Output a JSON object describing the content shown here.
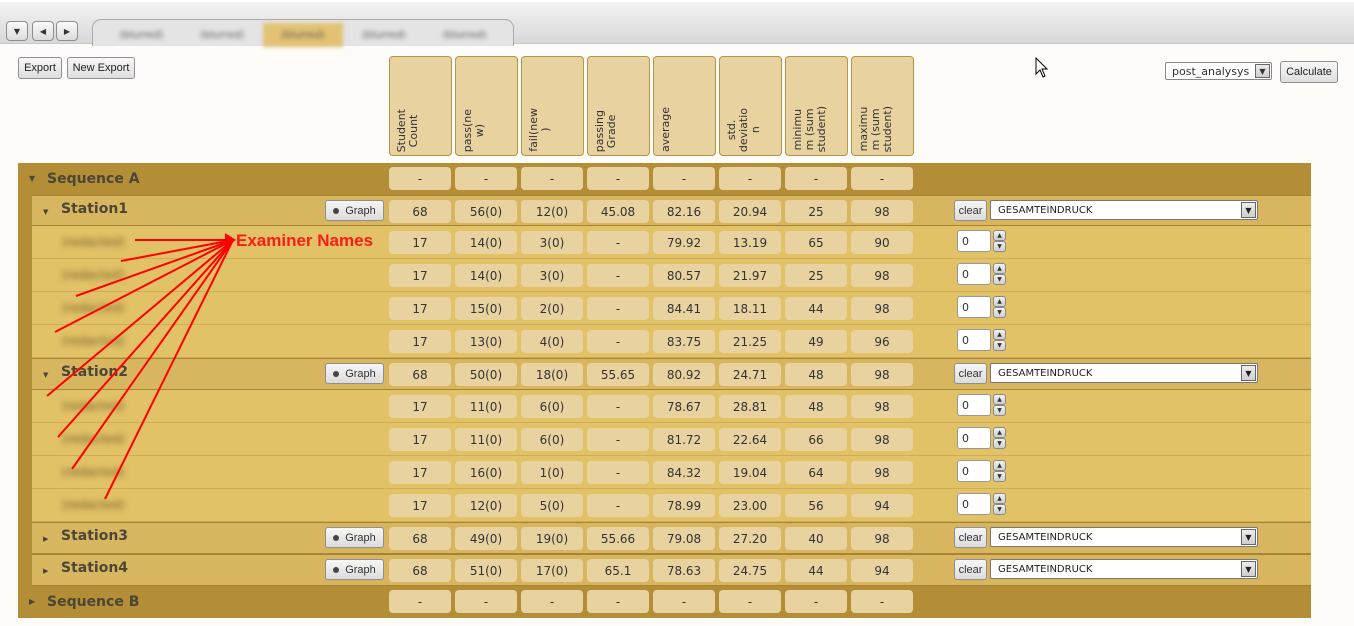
{
  "tabbar": {
    "nav_buttons": [
      {
        "icon": "caret-down-icon",
        "glyph": "▼"
      },
      {
        "icon": "caret-left-icon",
        "glyph": "◀"
      },
      {
        "icon": "caret-right-icon",
        "glyph": "▶"
      }
    ],
    "tabs": [
      {
        "label": "(blurred)",
        "active": false
      },
      {
        "label": "(blurred)",
        "active": false
      },
      {
        "label": "(blurred)",
        "active": true
      },
      {
        "label": "(blurred)",
        "active": false
      },
      {
        "label": "(blurred)",
        "active": false
      }
    ]
  },
  "toolbar": {
    "export_label": "Export",
    "new_export_label": "New Export",
    "analysis_select_value": "post_analysys",
    "calculate_label": "Calculate"
  },
  "columns": [
    "Student\nCount",
    "pass(ne\nw)",
    "fail(new\n)",
    "passing\nGrade",
    "average",
    "std.\ndeviatio\nn",
    "minimu\nm (sum\nstudent)",
    "maximu\nm (sum\nstudent)"
  ],
  "annotation": {
    "label": "Examiner Names",
    "color": "#ff0000"
  },
  "buttons": {
    "graph_label": "Graph",
    "clear_label": "clear"
  },
  "sequences": [
    {
      "name": "Sequence A",
      "expanded": true,
      "values": [
        "-",
        "-",
        "-",
        "-",
        "-",
        "-",
        "-",
        "-"
      ],
      "stations": [
        {
          "name": "Station1",
          "expanded": true,
          "criterion": "GESAMTEINDRUCK",
          "values": [
            "68",
            "56(0)",
            "12(0)",
            "45.08",
            "82.16",
            "20.94",
            "25",
            "98"
          ],
          "examiners": [
            {
              "name": "(redacted)",
              "values": [
                "17",
                "14(0)",
                "3(0)",
                "-",
                "79.92",
                "13.19",
                "65",
                "90"
              ],
              "weight": "0"
            },
            {
              "name": "(redacted)",
              "values": [
                "17",
                "14(0)",
                "3(0)",
                "-",
                "80.57",
                "21.97",
                "25",
                "98"
              ],
              "weight": "0"
            },
            {
              "name": "(redacted)",
              "values": [
                "17",
                "15(0)",
                "2(0)",
                "-",
                "84.41",
                "18.11",
                "44",
                "98"
              ],
              "weight": "0"
            },
            {
              "name": "(redacted)",
              "values": [
                "17",
                "13(0)",
                "4(0)",
                "-",
                "83.75",
                "21.25",
                "49",
                "96"
              ],
              "weight": "0"
            }
          ]
        },
        {
          "name": "Station2",
          "expanded": true,
          "criterion": "GESAMTEINDRUCK",
          "values": [
            "68",
            "50(0)",
            "18(0)",
            "55.65",
            "80.92",
            "24.71",
            "48",
            "98"
          ],
          "examiners": [
            {
              "name": "(redacted)",
              "values": [
                "17",
                "11(0)",
                "6(0)",
                "-",
                "78.67",
                "28.81",
                "48",
                "98"
              ],
              "weight": "0"
            },
            {
              "name": "(redacted)",
              "values": [
                "17",
                "11(0)",
                "6(0)",
                "-",
                "81.72",
                "22.64",
                "66",
                "98"
              ],
              "weight": "0"
            },
            {
              "name": "(redacted)",
              "values": [
                "17",
                "16(0)",
                "1(0)",
                "-",
                "84.32",
                "19.04",
                "64",
                "98"
              ],
              "weight": "0"
            },
            {
              "name": "(redacted)",
              "values": [
                "17",
                "12(0)",
                "5(0)",
                "-",
                "78.99",
                "23.00",
                "56",
                "94"
              ],
              "weight": "0"
            }
          ]
        },
        {
          "name": "Station3",
          "expanded": false,
          "criterion": "GESAMTEINDRUCK",
          "values": [
            "68",
            "49(0)",
            "19(0)",
            "55.66",
            "79.08",
            "27.20",
            "40",
            "98"
          ],
          "examiners": []
        },
        {
          "name": "Station4",
          "expanded": false,
          "criterion": "GESAMTEINDRUCK",
          "values": [
            "68",
            "51(0)",
            "17(0)",
            "65.1",
            "78.63",
            "24.75",
            "44",
            "94"
          ],
          "examiners": []
        }
      ]
    },
    {
      "name": "Sequence B",
      "expanded": false,
      "values": [
        "-",
        "-",
        "-",
        "-",
        "-",
        "-",
        "-",
        "-"
      ],
      "stations": []
    }
  ]
}
